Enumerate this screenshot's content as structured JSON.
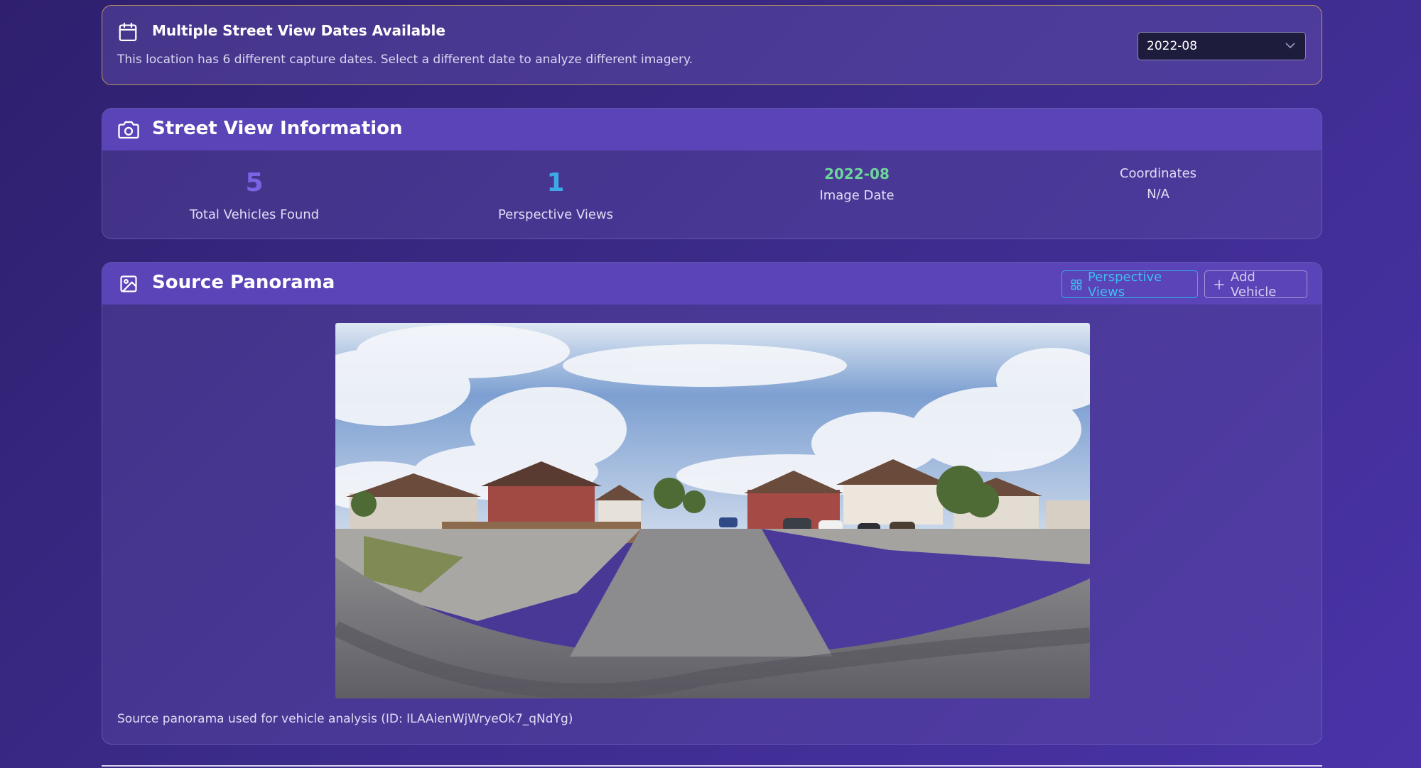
{
  "date_notice": {
    "title": "Multiple Street View Dates Available",
    "description": "This location has 6 different capture dates. Select a different date to analyze different imagery.",
    "selected_date": "2022-08",
    "icon": "calendar-icon"
  },
  "info": {
    "title": "Street View Information",
    "icon": "camera-icon",
    "stats": [
      {
        "value": "5",
        "label": "Total Vehicles Found",
        "color": "#7b63e6"
      },
      {
        "value": "1",
        "label": "Perspective Views",
        "color": "#3fa8e6"
      },
      {
        "value": "2022-08",
        "label": "Image Date",
        "color": "#6ed69a"
      },
      {
        "value": "N/A",
        "label": "Coordinates"
      }
    ]
  },
  "panorama": {
    "title": "Source Panorama",
    "icon": "image-icon",
    "perspective_button": "Perspective Views",
    "add_button": "Add Vehicle",
    "caption": "Source panorama used for vehicle analysis (ID: ILAAienWjWryeOk7_qNdYg)"
  },
  "colors": {
    "header_bg": "#5b43b8",
    "accent_cyan": "#3fbdf0",
    "accent_green": "#6ed69a",
    "notice_border": "#b8965a"
  }
}
